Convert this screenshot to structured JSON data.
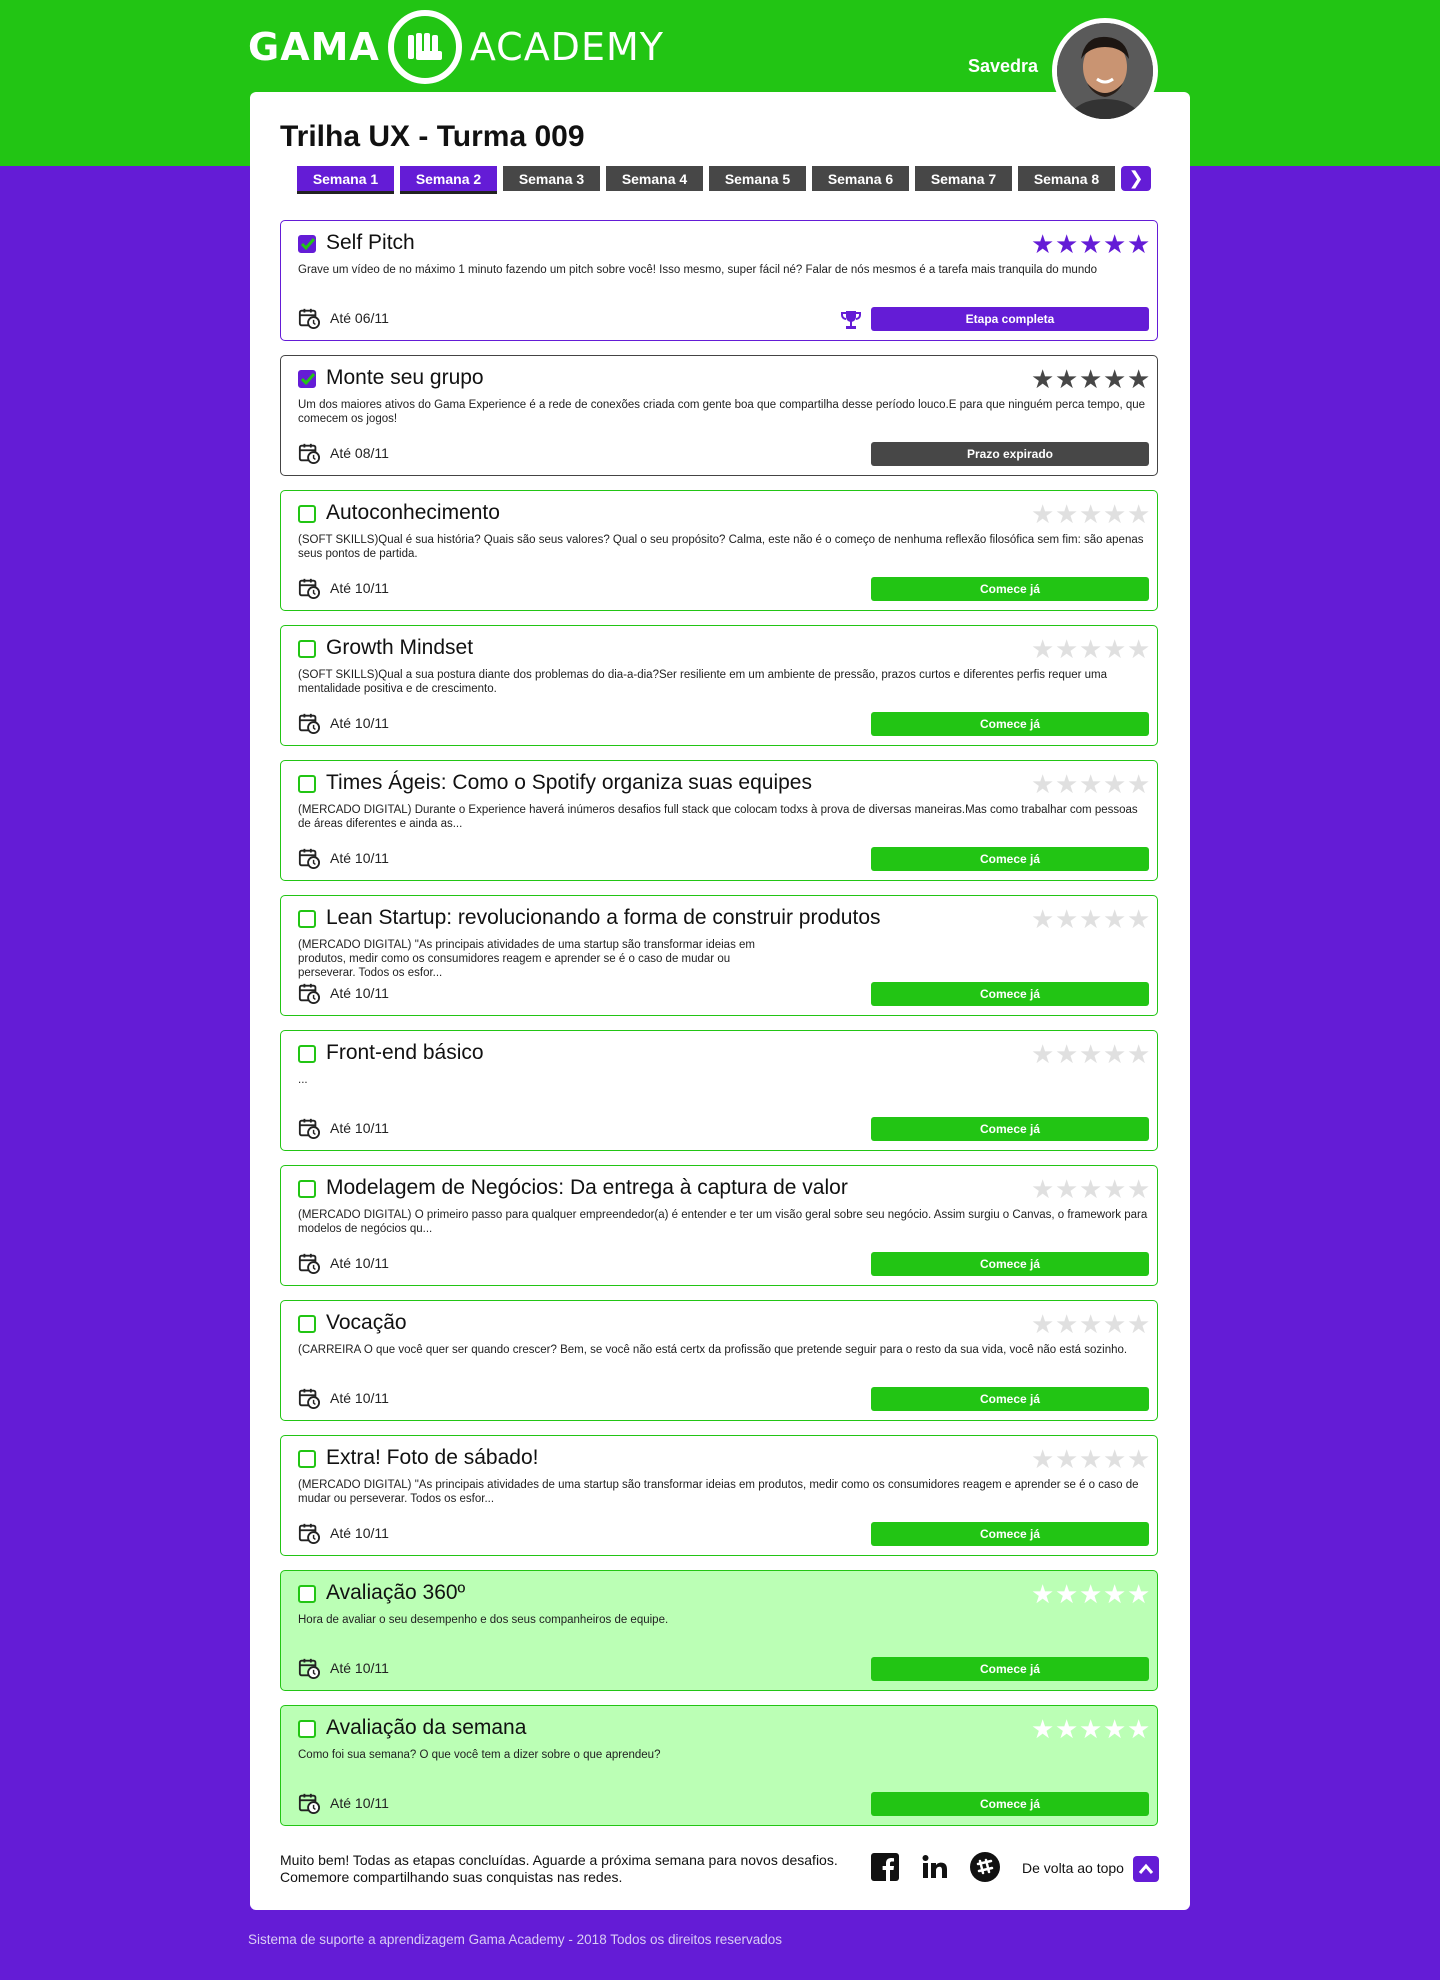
{
  "brand": {
    "left": "GAMA",
    "right": "ACADEMY"
  },
  "user": {
    "name": "Savedra"
  },
  "page": {
    "title": "Trilha UX - Turma 009"
  },
  "weeks": [
    {
      "label": "Semana 1",
      "active": true
    },
    {
      "label": "Semana 2",
      "active": true
    },
    {
      "label": "Semana 3",
      "active": false
    },
    {
      "label": "Semana 4",
      "active": false
    },
    {
      "label": "Semana 5",
      "active": false
    },
    {
      "label": "Semana 6",
      "active": false
    },
    {
      "label": "Semana 7",
      "active": false
    },
    {
      "label": "Semana 8",
      "active": false
    }
  ],
  "weeks_next": "❯",
  "tasks": [
    {
      "title": "Self Pitch",
      "status": "complete",
      "checked": true,
      "rating": 5,
      "star_style": "purple",
      "desc": "Grave um vídeo de no máximo 1 minuto fazendo um pitch sobre você! Isso mesmo,  super fácil né? Falar de nós mesmos é a tarefa mais tranquila do mundo",
      "due": "Até 06/11",
      "action": "Etapa completa"
    },
    {
      "title": "Monte seu grupo",
      "status": "expired",
      "checked": true,
      "rating": 5,
      "star_style": "gray",
      "desc": "Um dos maiores ativos do Gama Experience é a rede de conexões criada com gente boa que compartilha desse período louco.E para que ninguém perca tempo, que comecem os jogos!",
      "due": "Até 08/11",
      "action": "Prazo expirado"
    },
    {
      "title": "Autoconhecimento",
      "status": "open",
      "checked": false,
      "rating": 0,
      "star_style": "light",
      "desc": "(SOFT SKILLS)Qual é sua história? Quais são seus valores? Qual o seu  propósito? Calma, este não é o começo de nenhuma reflexão filosófica sem fim: são apenas seus pontos de partida.",
      "due": "Até 10/11",
      "action": "Comece já"
    },
    {
      "title": "Growth Mindset",
      "status": "open",
      "checked": false,
      "rating": 0,
      "star_style": "light",
      "desc": "(SOFT SKILLS)Qual a sua postura diante dos problemas do dia-a-dia?Ser resiliente em um ambiente de pressão, prazos curtos e diferentes perfis requer uma mentalidade positiva e de crescimento.",
      "due": "Até 10/11",
      "action": "Comece já"
    },
    {
      "title": "Times Ágeis: Como o Spotify organiza suas equipes",
      "status": "open",
      "checked": false,
      "rating": 0,
      "star_style": "light",
      "desc": "(MERCADO DIGITAL) Durante o Experience haverá inúmeros desafios full stack que  colocam todxs à prova de diversas maneiras.Mas como trabalhar com pessoas de áreas diferentes e ainda as...",
      "due": "Até 10/11",
      "action": "Comece já"
    },
    {
      "title": "Lean Startup: revolucionando a forma de construir produtos",
      "status": "open",
      "checked": false,
      "rating": 0,
      "star_style": "light",
      "desc": "(MERCADO DIGITAL) \"As principais atividades de uma startup são transformar ideias em produtos, medir como os consumidores reagem e aprender se é o caso de mudar ou perseverar. Todos os esfor...",
      "due": "Até 10/11",
      "action": "Comece já",
      "narrow": true
    },
    {
      "title": "Front-end básico",
      "status": "open",
      "checked": false,
      "rating": 0,
      "star_style": "light",
      "desc": "...",
      "due": "Até 10/11",
      "action": "Comece já"
    },
    {
      "title": "Modelagem de Negócios: Da entrega à captura de valor",
      "status": "open",
      "checked": false,
      "rating": 0,
      "star_style": "light",
      "desc": "(MERCADO DIGITAL) O primeiro passo para qualquer empreendedor(a) é entender e ter um visão geral sobre seu negócio. Assim surgiu o Canvas, o framework para modelos de negócios qu...",
      "due": "Até 10/11",
      "action": "Comece já"
    },
    {
      "title": "Vocação",
      "status": "open",
      "checked": false,
      "rating": 0,
      "star_style": "light",
      "desc": "(CARREIRA O que você quer ser quando crescer? Bem, se você não está certx da profissão que pretende seguir para o resto da sua vida, você não está sozinho.",
      "due": "Até 10/11",
      "action": "Comece já"
    },
    {
      "title": "Extra! Foto de sábado!",
      "status": "open",
      "checked": false,
      "rating": 0,
      "star_style": "light",
      "desc": "(MERCADO DIGITAL) \"As principais atividades de uma startup são transformar ideias em produtos, medir como os consumidores reagem e aprender se é o caso de mudar ou perseverar. Todos os esfor...",
      "due": "Até 10/11",
      "action": "Comece já"
    },
    {
      "title": "Avaliação 360º",
      "status": "open",
      "checked": false,
      "rating": 0,
      "star_style": "white",
      "highlight": true,
      "desc": "Hora de avaliar o seu desempenho e dos seus companheiros de equipe.",
      "due": "Até 10/11",
      "action": "Comece já"
    },
    {
      "title": "Avaliação da semana",
      "status": "open",
      "checked": false,
      "rating": 0,
      "star_style": "white",
      "highlight": true,
      "desc": "Como foi sua semana? O que você tem a dizer sobre o que aprendeu?",
      "due": "Até 10/11",
      "action": "Comece já"
    }
  ],
  "bottom": {
    "message_line1": "Muito bem! Todas as etapas concluídas. Aguarde a próxima semana para novos desafios.",
    "message_line2": "Comemore compartilhando suas conquistas nas redes.",
    "back_to_top": "De volta ao topo",
    "social": [
      "facebook-icon",
      "linkedin-icon",
      "slack-icon"
    ]
  },
  "footer": "Sistema de suporte a aprendizagem Gama Academy - 2018 Todos os direitos reservados",
  "colors": {
    "green": "#22c514",
    "purple": "#641cd6",
    "dark": "#474747",
    "highlight": "#bbffb5"
  }
}
